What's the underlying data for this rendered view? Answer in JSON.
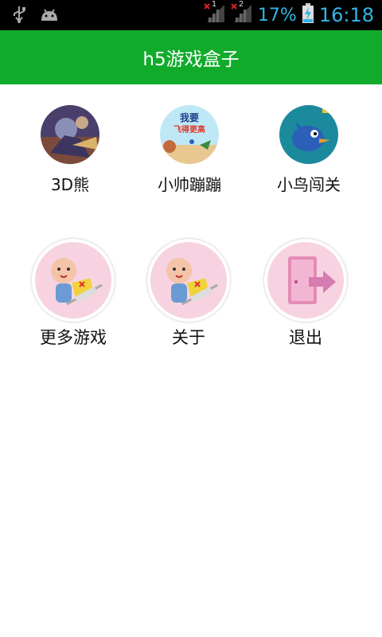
{
  "status_bar": {
    "icons": [
      "usb-icon",
      "android-icon",
      "signal-sim1-icon",
      "signal-sim2-icon",
      "battery-charging-icon"
    ],
    "sim1_label": "1",
    "sim2_label": "2",
    "battery": "17%",
    "time": "16:18"
  },
  "app": {
    "title": "h5游戏盒子",
    "accent_color": "#11ab2b"
  },
  "games": [
    {
      "label": "3D熊",
      "icon": "game-3d-bear-icon"
    },
    {
      "label": "小帅蹦蹦",
      "icon": "game-jump-icon",
      "art_text_1": "我要",
      "art_text_2": "飞得更高"
    },
    {
      "label": "小鸟闯关",
      "icon": "game-bird-icon"
    }
  ],
  "menu": [
    {
      "label": "更多游戏",
      "icon": "baby-icon"
    },
    {
      "label": "关于",
      "icon": "baby-icon"
    },
    {
      "label": "退出",
      "icon": "exit-door-icon"
    }
  ]
}
